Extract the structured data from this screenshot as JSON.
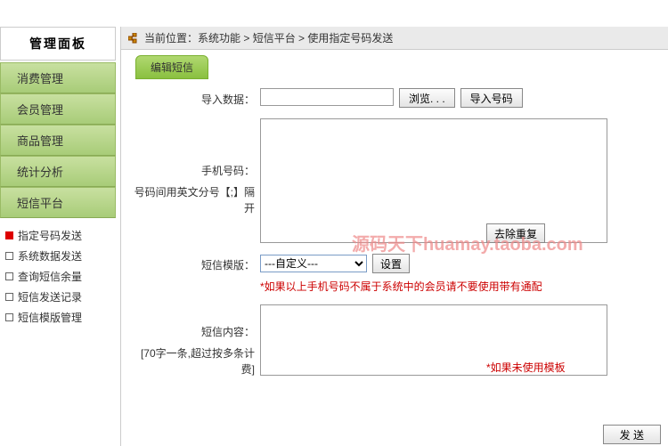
{
  "sidebar": {
    "title": "管理面板",
    "menu": [
      {
        "label": "消费管理"
      },
      {
        "label": "会员管理"
      },
      {
        "label": "商品管理"
      },
      {
        "label": "统计分析"
      },
      {
        "label": "短信平台"
      }
    ],
    "sub": [
      {
        "label": "指定号码发送",
        "active": true
      },
      {
        "label": "系统数据发送",
        "active": false
      },
      {
        "label": "查询短信余量",
        "active": false
      },
      {
        "label": "短信发送记录",
        "active": false
      },
      {
        "label": "短信模版管理",
        "active": false
      }
    ]
  },
  "breadcrumb": {
    "prefix": "当前位置：",
    "path": "系统功能 > 短信平台 > 使用指定号码发送"
  },
  "panel": {
    "tab": "编辑短信",
    "import_label": "导入数据：",
    "browse_btn": "浏览. . .",
    "import_btn": "导入号码",
    "phone_label": "手机号码：",
    "phone_hint": "号码间用英文分号【;】隔开",
    "dedup_btn": "去除重复",
    "template_label": "短信模版：",
    "template_option": "---自定义---",
    "set_btn": "设置",
    "template_hint": "*如果以上手机号码不属于系统中的会员请不要使用带有通配",
    "content_label": "短信内容：",
    "content_hint": "[70字一条,超过按多条计费]",
    "content_hint2": "*如果未使用模板",
    "send_btn": "发 送"
  },
  "watermark": "源码天下huamay.taoba.com"
}
